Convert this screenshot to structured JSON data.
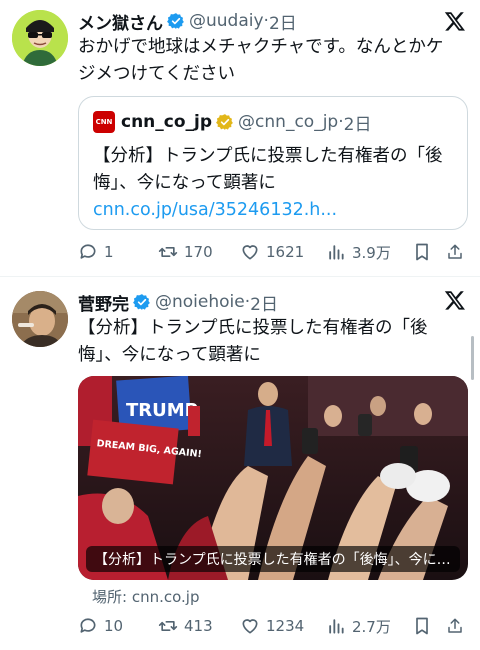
{
  "tweet1": {
    "name": "メン獄さん",
    "handle": "@uudaiy",
    "dot": "·",
    "time": "2日",
    "text": "おかげで地球はメチャクチャです。なんとかケジメつけてください",
    "quote": {
      "logo_text": "CNN",
      "name": "cnn_co_jp",
      "handle": "@cnn_co_jp",
      "dot": "·",
      "time": "2日",
      "text": "【分析】トランプ氏に投票した有権者の「後悔」、今になって顕著に",
      "link": "cnn.co.jp/usa/35246132.h..."
    },
    "stats": {
      "replies": "1",
      "reposts": "170",
      "likes": "1621",
      "views": "3.9万"
    }
  },
  "tweet2": {
    "name": "菅野完",
    "handle": "@noiehoie",
    "dot": "·",
    "time": "2日",
    "text": "【分析】トランプ氏に投票した有権者の「後悔」、今になって顕著に",
    "media_caption": "【分析】トランプ氏に投票した有権者の「後悔」、今にな…",
    "sign_trump": "TRUMP",
    "sign_dream": "DREAM BIG, AGAIN!",
    "source": "場所: cnn.co.jp",
    "stats": {
      "replies": "10",
      "reposts": "413",
      "likes": "1234",
      "views": "2.7万"
    }
  },
  "colors": {
    "accent": "#1d9bf0",
    "verified_blue": "#1d9bf0",
    "verified_gold": "#e2b719",
    "muted": "#536471",
    "cnn_red": "#cc0000"
  }
}
